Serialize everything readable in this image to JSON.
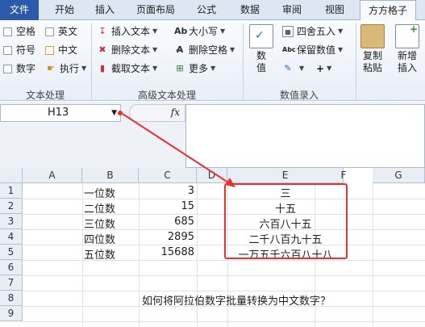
{
  "tabs": [
    "文件",
    "开始",
    "插入",
    "页面布局",
    "公式",
    "数据",
    "审阅",
    "视图",
    "方方格子"
  ],
  "ribbon": {
    "text_processing": {
      "items": [
        "空格",
        "英文",
        "符号",
        "中文",
        "数字",
        "执行"
      ],
      "group_label": "文本处理"
    },
    "advanced_text": {
      "items": [
        "插入文本",
        "大小写",
        "删除文本",
        "删除空格",
        "截取文本",
        "更多"
      ],
      "group_label": "高级文本处理"
    },
    "numeric": {
      "value_btn": "数\n值",
      "value_label_1": "数",
      "value_label_2": "值",
      "round": "四舍五入",
      "keep_value": "保留数值",
      "group_label": "数值录入"
    },
    "copy_paste": {
      "copy": "复制",
      "paste": "粘贴"
    },
    "insert": {
      "new": "新增",
      "insert": "插入"
    }
  },
  "name_box": "H13",
  "fx": "fx",
  "columns": [
    "A",
    "B",
    "C",
    "D",
    "E",
    "F",
    "G"
  ],
  "rows": [
    "1",
    "2",
    "3",
    "4",
    "5",
    "6",
    "7",
    "8",
    "9"
  ],
  "cells": {
    "b": [
      "一位数",
      "二位数",
      "三位数",
      "四位数",
      "五位数"
    ],
    "c": [
      "3",
      "15",
      "685",
      "2895",
      "15688"
    ],
    "e": [
      "三",
      "十五",
      "六百八十五",
      "二千八百九十五",
      "一万五千六百八十八"
    ],
    "question": "如何将阿拉伯数字批量转换为中文数字？"
  },
  "colors": {
    "highlight": "#e8322f",
    "file_tab": "#2a5aa9"
  }
}
